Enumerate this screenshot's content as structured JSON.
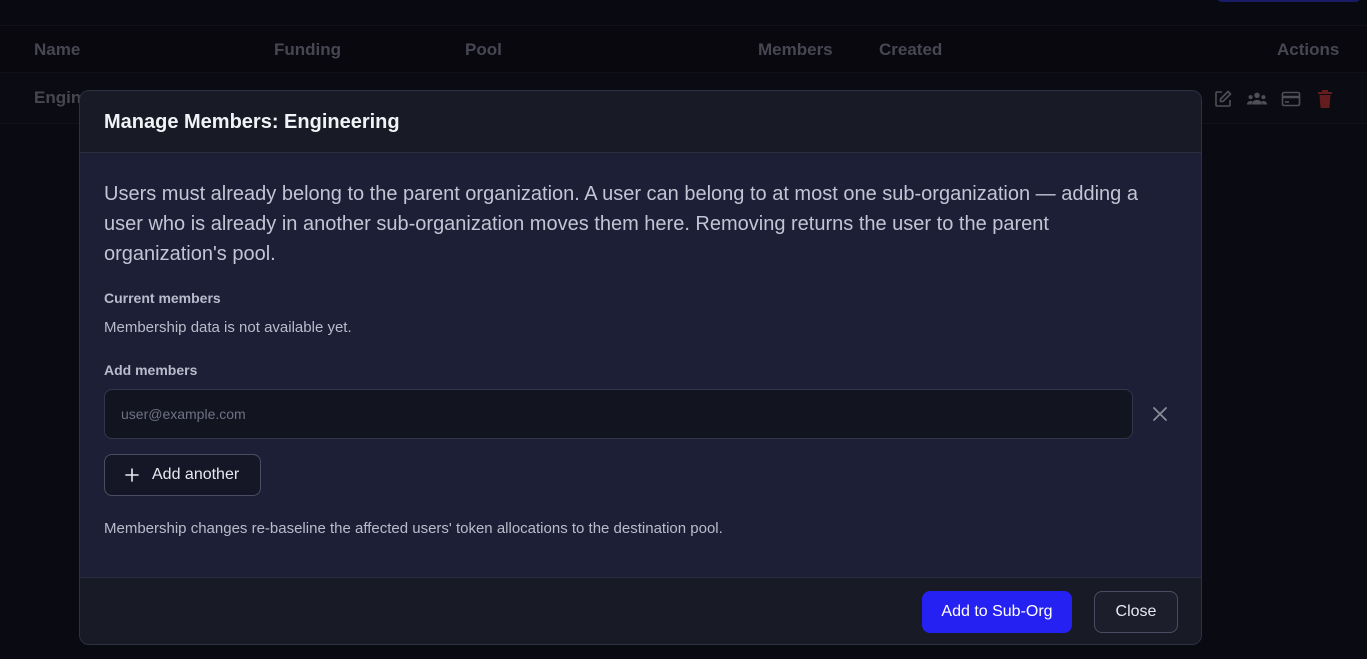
{
  "table": {
    "columns": [
      "Name",
      "Funding",
      "Pool",
      "Members",
      "Created",
      "Actions"
    ],
    "row": {
      "name": "Engin",
      "actions": [
        "edit-icon",
        "members-icon",
        "card-icon",
        "trash-icon"
      ]
    }
  },
  "modal": {
    "title": "Manage Members: Engineering",
    "description": "Users must already belong to the parent organization. A user can belong to at most one sub-organization — adding a user who is already in another sub-organization moves them here. Removing returns the user to the parent organization's pool.",
    "current_members_label": "Current members",
    "current_members_empty": "Membership data is not available yet.",
    "add_members_label": "Add members",
    "email_placeholder": "user@example.com",
    "email_value": "",
    "add_another_label": "Add another",
    "footnote": "Membership changes re-baseline the affected users' token allocations to the destination pool.",
    "primary_label": "Add to Sub-Org",
    "close_label": "Close"
  },
  "colors": {
    "accent": "#2521f2",
    "danger": "#b3302c",
    "modal_body": "#1c1f36",
    "modal_header": "#181a26"
  }
}
